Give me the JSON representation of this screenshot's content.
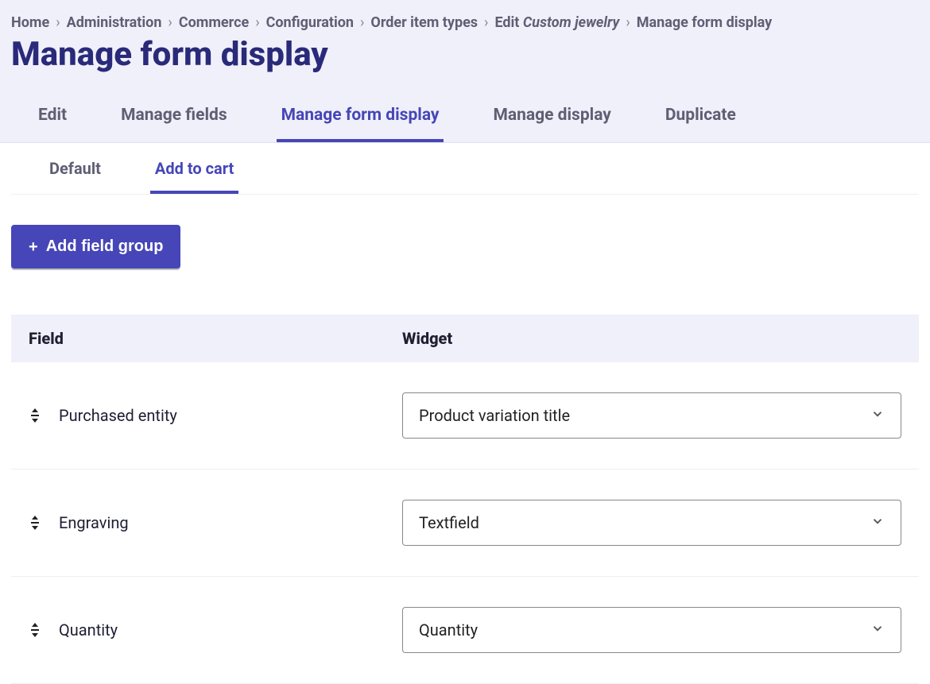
{
  "breadcrumb": [
    {
      "label": "Home",
      "link": true
    },
    {
      "label": "Administration",
      "link": true
    },
    {
      "label": "Commerce",
      "link": true
    },
    {
      "label": "Configuration",
      "link": true
    },
    {
      "label": "Order item types",
      "link": true
    },
    {
      "html": "Edit <em>Custom jewelry</em>",
      "link": true
    },
    {
      "label": "Manage form display",
      "link": false
    }
  ],
  "page_title": "Manage form display",
  "primary_tabs": [
    {
      "label": "Edit",
      "active": false
    },
    {
      "label": "Manage fields",
      "active": false
    },
    {
      "label": "Manage form display",
      "active": true
    },
    {
      "label": "Manage display",
      "active": false
    },
    {
      "label": "Duplicate",
      "active": false
    }
  ],
  "secondary_tabs": [
    {
      "label": "Default",
      "active": false
    },
    {
      "label": "Add to cart",
      "active": true
    }
  ],
  "add_group_label": "Add field group",
  "table": {
    "headers": {
      "field": "Field",
      "widget": "Widget"
    },
    "rows": [
      {
        "field": "Purchased entity",
        "widget": "Product variation title"
      },
      {
        "field": "Engraving",
        "widget": "Textfield"
      },
      {
        "field": "Quantity",
        "widget": "Quantity"
      }
    ]
  }
}
